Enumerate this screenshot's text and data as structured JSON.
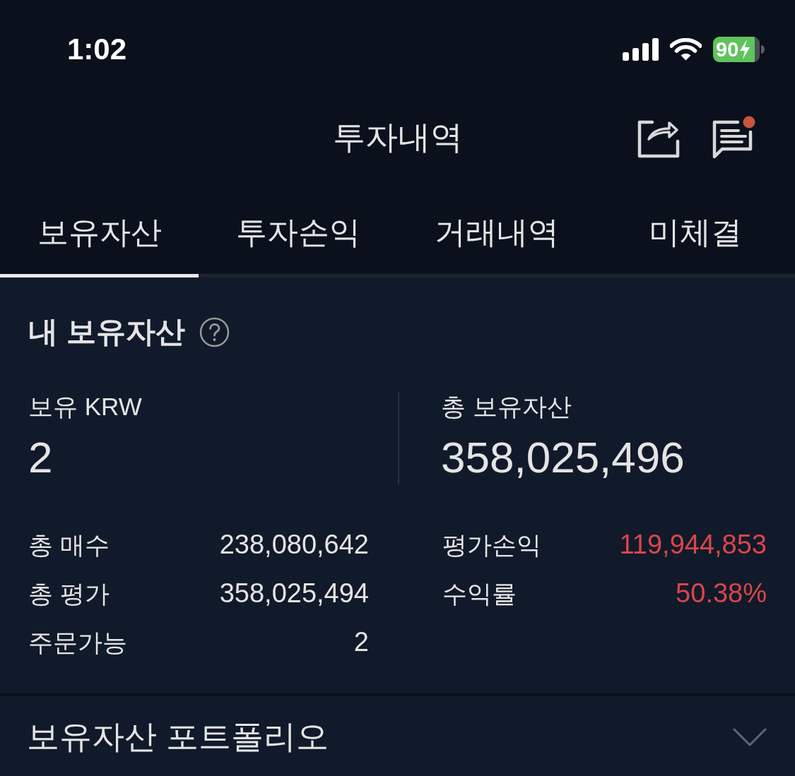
{
  "status_bar": {
    "time": "1:02",
    "battery": "90",
    "charging": true
  },
  "header": {
    "title": "투자내역",
    "unread": true
  },
  "tabs": [
    {
      "label": "보유자산",
      "selected": true
    },
    {
      "label": "투자손익",
      "selected": false
    },
    {
      "label": "거래내역",
      "selected": false
    },
    {
      "label": "미체결",
      "selected": false
    }
  ],
  "summary": {
    "title": "내 보유자산",
    "held_krw": {
      "label": "보유 KRW",
      "value": "2"
    },
    "total_assets": {
      "label": "총 보유자산",
      "value": "358,025,496"
    },
    "left_rows": [
      {
        "label": "총 매수",
        "value": "238,080,642"
      },
      {
        "label": "총 평가",
        "value": "358,025,494"
      },
      {
        "label": "주문가능",
        "value": "2"
      }
    ],
    "right_rows": [
      {
        "label": "평가손익",
        "value": "119,944,853",
        "kind": "gain"
      },
      {
        "label": "수익률",
        "value": "50.38%",
        "kind": "gain"
      }
    ]
  },
  "portfolio": {
    "title": "보유자산 포트폴리오",
    "expanded": false
  }
}
